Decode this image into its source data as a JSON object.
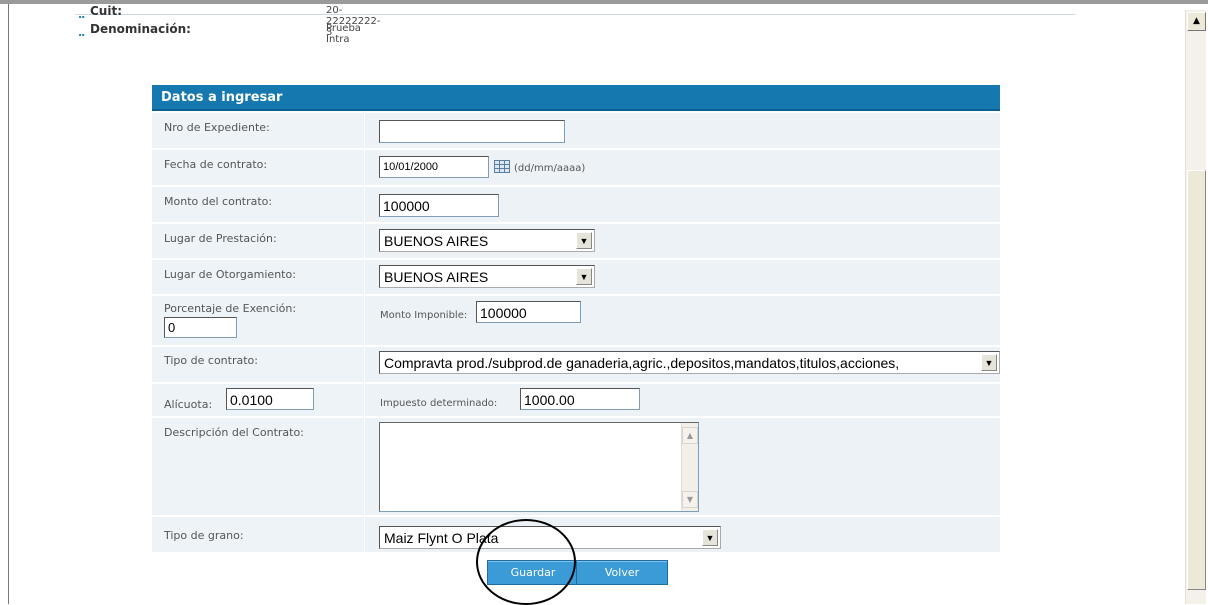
{
  "header": {
    "cuit_label": "Cuit:",
    "cuit_value": "20-22222222-3",
    "denominacion_label": "Denominación:",
    "denominacion_value": "Prueba Intra",
    "bullet": ".."
  },
  "panel": {
    "title": "Datos a ingresar"
  },
  "form": {
    "nro_expediente": {
      "label": "Nro de Expediente:",
      "value": ""
    },
    "fecha_contrato": {
      "label": "Fecha de contrato:",
      "value": "10/01/2000",
      "format_hint": "(dd/mm/aaaa)"
    },
    "monto_contrato": {
      "label": "Monto del contrato:",
      "value": "100000"
    },
    "lugar_prestacion": {
      "label": "Lugar de Prestación:",
      "value": "BUENOS AIRES"
    },
    "lugar_otorgamiento": {
      "label": "Lugar de Otorgamiento:",
      "value": "BUENOS AIRES"
    },
    "porcentaje_exencion": {
      "label": "Porcentaje de Exención:",
      "value": "0"
    },
    "monto_imponible": {
      "label": "Monto Imponible:",
      "value": "100000"
    },
    "tipo_contrato": {
      "label": "Tipo de contrato:",
      "value": "Compravta prod./subprod.de ganaderia,agric.,depositos,mandatos,titulos,acciones,"
    },
    "alicuota": {
      "label": "Alícuota:",
      "value": "0.0100"
    },
    "impuesto_determinado": {
      "label": "Impuesto determinado:",
      "value": "1000.00"
    },
    "descripcion": {
      "label": "Descripción del Contrato:",
      "value": ""
    },
    "tipo_grano": {
      "label": "Tipo de grano:",
      "value": "Maiz Flynt O Plata"
    }
  },
  "buttons": {
    "guardar": "Guardar",
    "volver": "Volver"
  },
  "icons": {
    "dropdown": "▼",
    "scroll_up": "▲",
    "scroll_down": "▼"
  },
  "colors": {
    "panel_header": "#1579b0",
    "button": "#3a9bd6"
  }
}
